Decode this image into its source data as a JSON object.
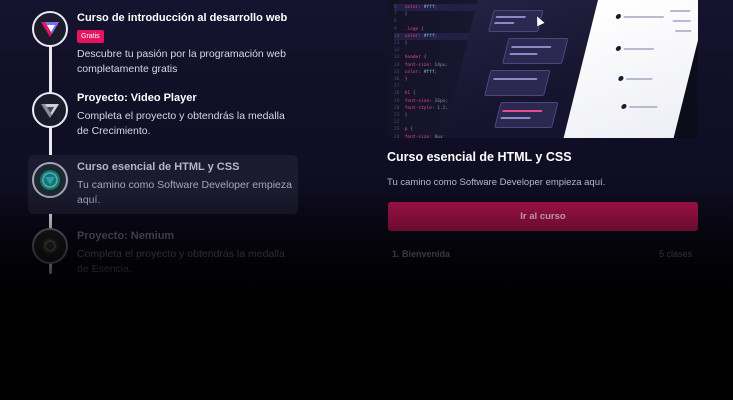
{
  "timeline": {
    "steps": [
      {
        "title": "Curso de introducción al desarrollo web",
        "tag": "Gratis",
        "desc": "Descubre tu pasión por la programación web completamente gratis",
        "icon": "triangle-logo-icon"
      },
      {
        "title": "Proyecto: Video Player",
        "desc": "Completa el proyecto y obtendrás la medalla de Crecimiento.",
        "icon": "medal-icon"
      },
      {
        "title": "Curso esencial de HTML y CSS",
        "desc": "Tu camino como Software Developer empieza aquí.",
        "icon": "course-badge-icon"
      },
      {
        "title": "Proyecto: Nemium",
        "desc": "Completa el proyecto y obtendrás la medalla de Esencia.",
        "icon": "medal-icon"
      }
    ]
  },
  "course": {
    "title": "Curso esencial de HTML y CSS",
    "desc": "Tu camino como Software Developer empieza aquí.",
    "cta": "Ir al curso",
    "module": {
      "label": "1. Bienvenida",
      "count": "5 clases"
    }
  },
  "colors": {
    "accent": "#e4145f",
    "cta": "#a8124a",
    "background": "#15132e"
  }
}
